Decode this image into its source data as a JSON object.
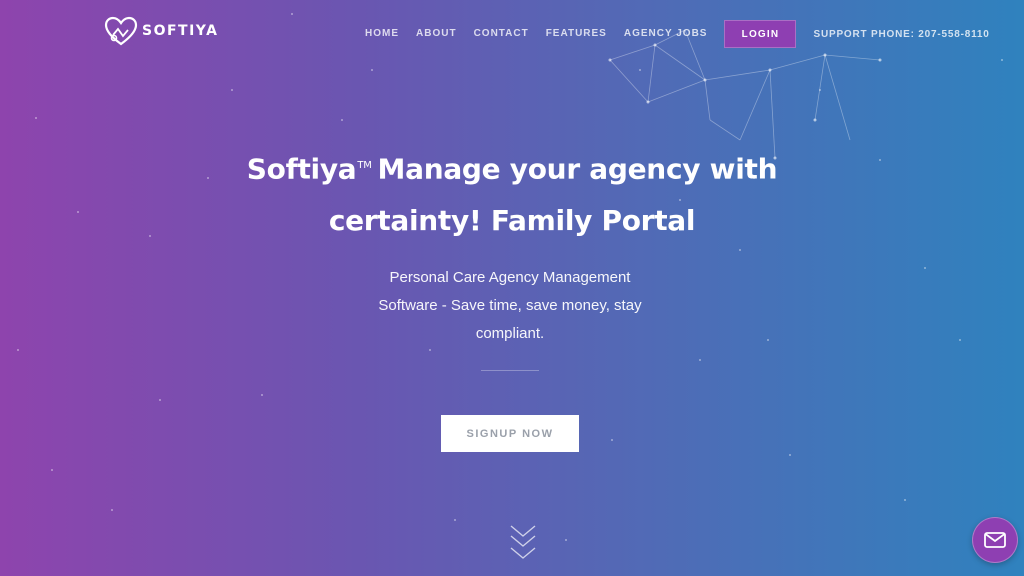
{
  "brand": {
    "name": "SOFTIYA",
    "logo_icon": "heart-logo-icon"
  },
  "nav": {
    "items": [
      "HOME",
      "ABOUT",
      "CONTACT",
      "FEATURES",
      "AGENCY JOBS"
    ],
    "login_label": "LOGIN",
    "support_phone": "SUPPORT PHONE: 207-558-8110"
  },
  "hero": {
    "title_brand": "Softiya",
    "trademark": "TM",
    "title_line1_rest": "Manage your agency with",
    "title_line2": "certainty! Family Portal",
    "subtitle": "Personal Care Agency Management Software - Save time, save money, stay compliant.",
    "signup_label": "SIGNUP NOW"
  },
  "icons": {
    "scroll": "chevron-down-double-icon",
    "chat": "envelope-icon"
  },
  "colors": {
    "gradient_start": "#8e44ad",
    "gradient_end": "#2f82be",
    "accent": "#8e3fb2"
  }
}
